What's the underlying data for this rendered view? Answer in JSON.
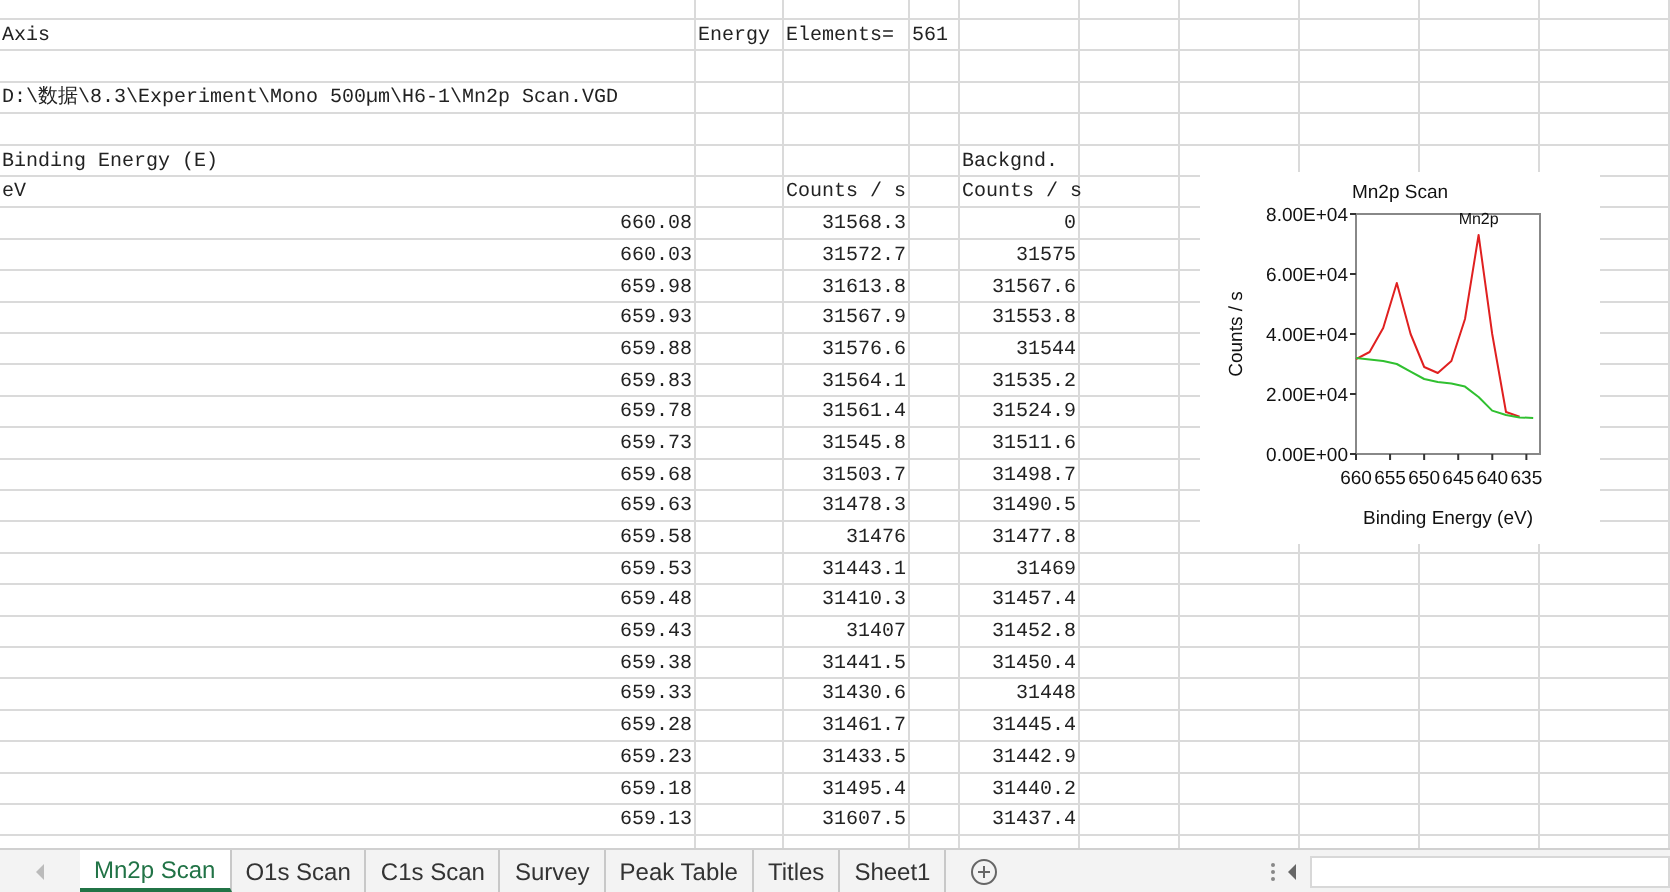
{
  "sheet": {
    "rows": [
      {
        "kind": "text",
        "column_1": "Axis",
        "column_2": "Energy",
        "column_3": "Elements=",
        "column_4": "561"
      },
      {
        "kind": "blank"
      },
      {
        "kind": "text",
        "column_1": "D:\\数据\\8.3\\Experiment\\Mono 500µm\\H6-1\\Mn2p Scan.VGD"
      },
      {
        "kind": "blank"
      },
      {
        "kind": "text",
        "column_1": "Binding Energy (E)",
        "column_5": "Backgnd."
      },
      {
        "kind": "text",
        "column_1": "eV",
        "column_3": "Counts / s",
        "column_5": "Counts / s"
      },
      {
        "kind": "number",
        "column_1": "660.08",
        "column_3": "31568.3",
        "column_5": "0"
      },
      {
        "kind": "number",
        "column_1": "660.03",
        "column_3": "31572.7",
        "column_5": "31575"
      },
      {
        "kind": "number",
        "column_1": "659.98",
        "column_3": "31613.8",
        "column_5": "31567.6"
      },
      {
        "kind": "number",
        "column_1": "659.93",
        "column_3": "31567.9",
        "column_5": "31553.8"
      },
      {
        "kind": "number",
        "column_1": "659.88",
        "column_3": "31576.6",
        "column_5": "31544"
      },
      {
        "kind": "number",
        "column_1": "659.83",
        "column_3": "31564.1",
        "column_5": "31535.2"
      },
      {
        "kind": "number",
        "column_1": "659.78",
        "column_3": "31561.4",
        "column_5": "31524.9"
      },
      {
        "kind": "number",
        "column_1": "659.73",
        "column_3": "31545.8",
        "column_5": "31511.6"
      },
      {
        "kind": "number",
        "column_1": "659.68",
        "column_3": "31503.7",
        "column_5": "31498.7"
      },
      {
        "kind": "number",
        "column_1": "659.63",
        "column_3": "31478.3",
        "column_5": "31490.5"
      },
      {
        "kind": "number",
        "column_1": "659.58",
        "column_3": "31476",
        "column_5": "31477.8"
      },
      {
        "kind": "number",
        "column_1": "659.53",
        "column_3": "31443.1",
        "column_5": "31469"
      },
      {
        "kind": "number",
        "column_1": "659.48",
        "column_3": "31410.3",
        "column_5": "31457.4"
      },
      {
        "kind": "number",
        "column_1": "659.43",
        "column_3": "31407",
        "column_5": "31452.8"
      },
      {
        "kind": "number",
        "column_1": "659.38",
        "column_3": "31441.5",
        "column_5": "31450.4"
      },
      {
        "kind": "number",
        "column_1": "659.33",
        "column_3": "31430.6",
        "column_5": "31448"
      },
      {
        "kind": "number",
        "column_1": "659.28",
        "column_3": "31461.7",
        "column_5": "31445.4"
      },
      {
        "kind": "number",
        "column_1": "659.23",
        "column_3": "31433.5",
        "column_5": "31442.9"
      },
      {
        "kind": "number",
        "column_1": "659.18",
        "column_3": "31495.4",
        "column_5": "31440.2"
      },
      {
        "kind": "number",
        "column_1": "659.13",
        "column_3": "31607.5",
        "column_5": "31437.4"
      }
    ]
  },
  "chart": {
    "chart_data": {
      "type": "line",
      "title": "Mn2p Scan",
      "xlabel": "Binding Energy (eV)",
      "ylabel": "Counts / s",
      "x": [
        660,
        658,
        656,
        654,
        652,
        650,
        648,
        646,
        644,
        642,
        640,
        638,
        636,
        634
      ],
      "series": [
        {
          "color": "#e02020",
          "values": [
            31600,
            34000,
            42000,
            57000,
            40000,
            29000,
            27000,
            31000,
            45000,
            73000,
            40000,
            14000,
            12500,
            null
          ]
        },
        {
          "color": "#30c030",
          "values": [
            32000,
            31500,
            31000,
            30000,
            27500,
            25000,
            24000,
            23500,
            22500,
            19000,
            14500,
            13000,
            12200,
            12000
          ]
        }
      ],
      "xlim": [
        660,
        633
      ],
      "ylim": [
        0,
        80000
      ],
      "xticks": [
        660,
        655,
        650,
        645,
        640,
        635
      ],
      "yticks": [
        {
          "value": 0,
          "label": "0.00E+00"
        },
        {
          "value": 20000,
          "label": "2.00E+04"
        },
        {
          "value": 40000,
          "label": "4.00E+04"
        },
        {
          "value": 60000,
          "label": "6.00E+04"
        },
        {
          "value": 80000,
          "label": "8.00E+04"
        }
      ],
      "annotations": [
        {
          "text": "Mn2p",
          "x": 642,
          "y": 74000
        }
      ]
    }
  },
  "sheet_tabs": [
    {
      "label": "Mn2p Scan",
      "selected": true
    },
    {
      "label": "O1s Scan",
      "selected": false
    },
    {
      "label": "C1s Scan",
      "selected": false
    },
    {
      "label": "Survey",
      "selected": false
    },
    {
      "label": "Peak Table",
      "selected": false
    },
    {
      "label": "Titles",
      "selected": false
    },
    {
      "label": "Sheet1",
      "selected": false
    }
  ]
}
